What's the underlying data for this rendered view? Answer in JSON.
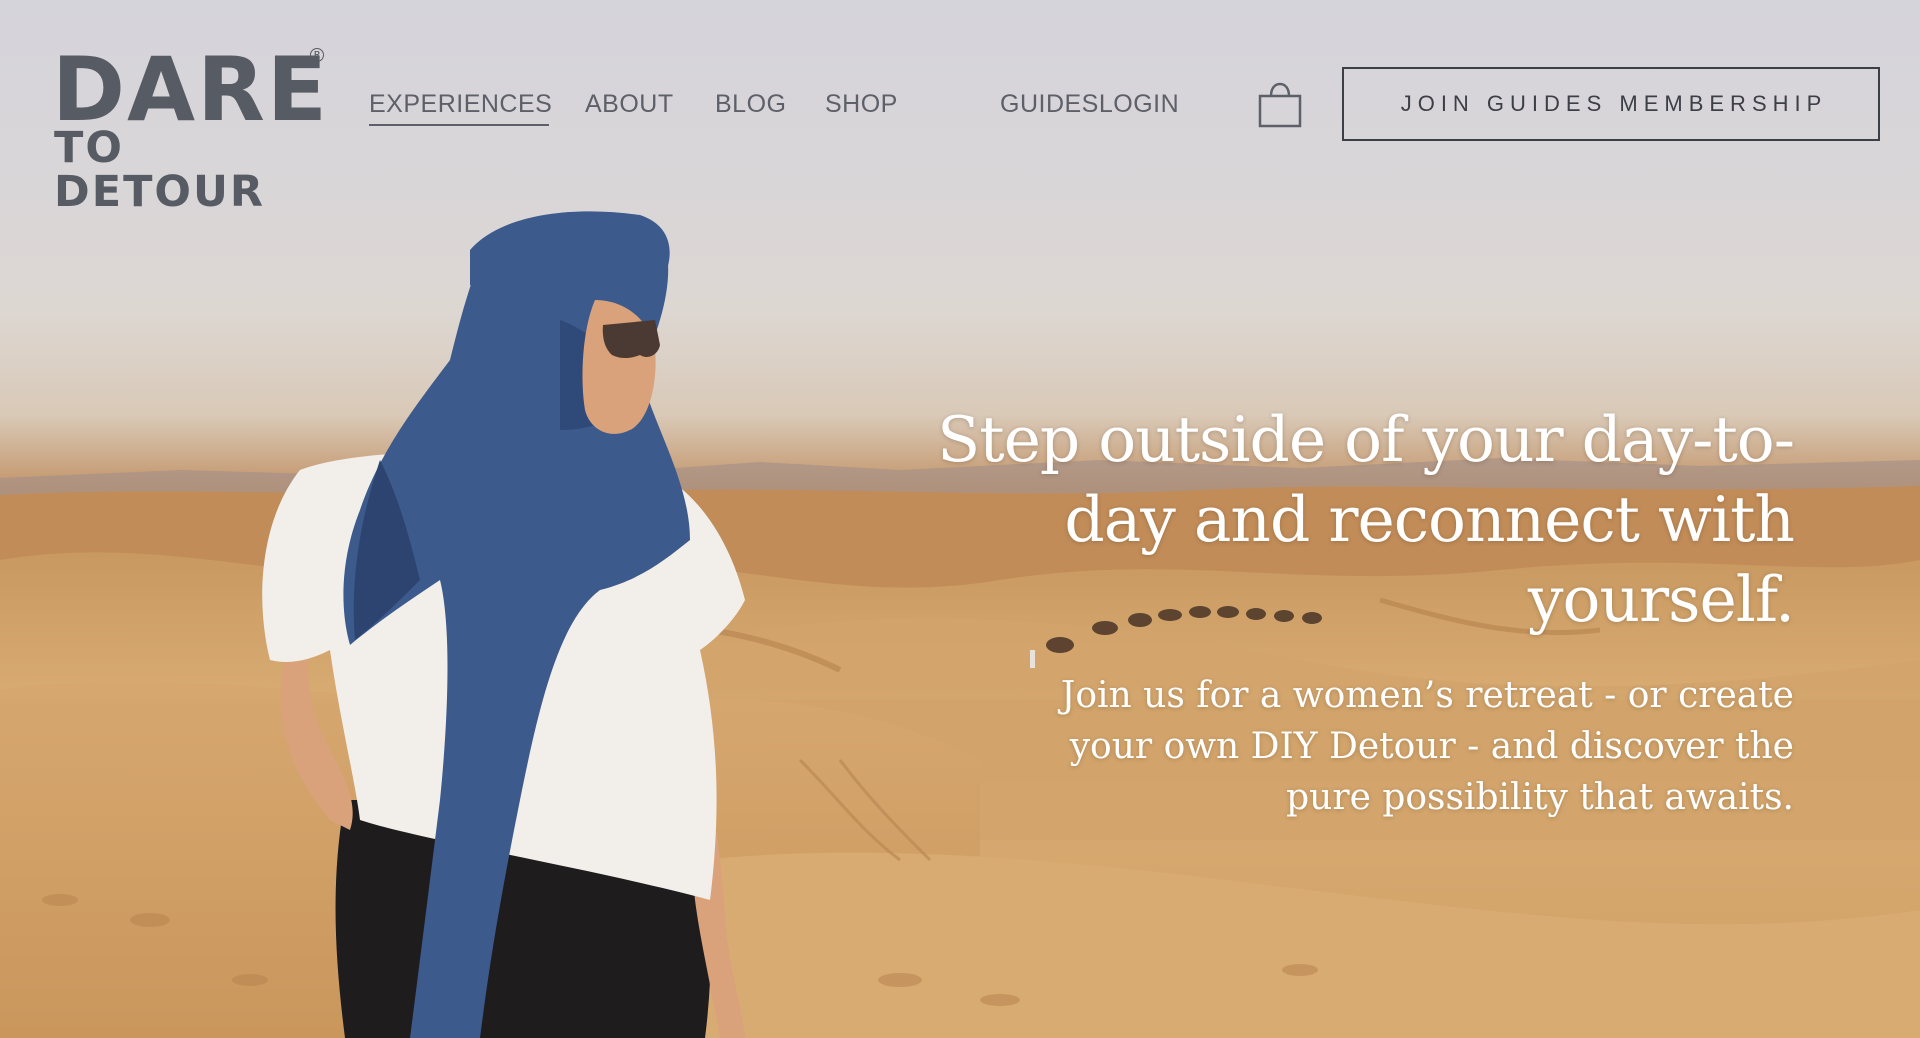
{
  "brand": {
    "logo_top": "DARE",
    "logo_bottom": "TO DETOUR",
    "registered_mark": "R"
  },
  "nav": {
    "experiences": "EXPERIENCES",
    "about": "ABOUT",
    "blog": "BLOG",
    "shop": "SHOP",
    "guides_login": "GUIDESLOGIN"
  },
  "header": {
    "cart_icon": "shopping-bag-icon",
    "cta_label": "JOIN GUIDES MEMBERSHIP"
  },
  "hero": {
    "headline": "Step outside of your day-to-day and reconnect with yourself.",
    "subhead": "Join us for a women’s retreat - or create your own DIY Detour - and discover the pure possibility that awaits."
  },
  "colors": {
    "nav_text": "#5e6069",
    "logo": "#575b63",
    "cta_border": "#3d3f46",
    "hero_text": "#ffffff",
    "scarf": "#3d5a89",
    "sand": "#cfa064"
  }
}
